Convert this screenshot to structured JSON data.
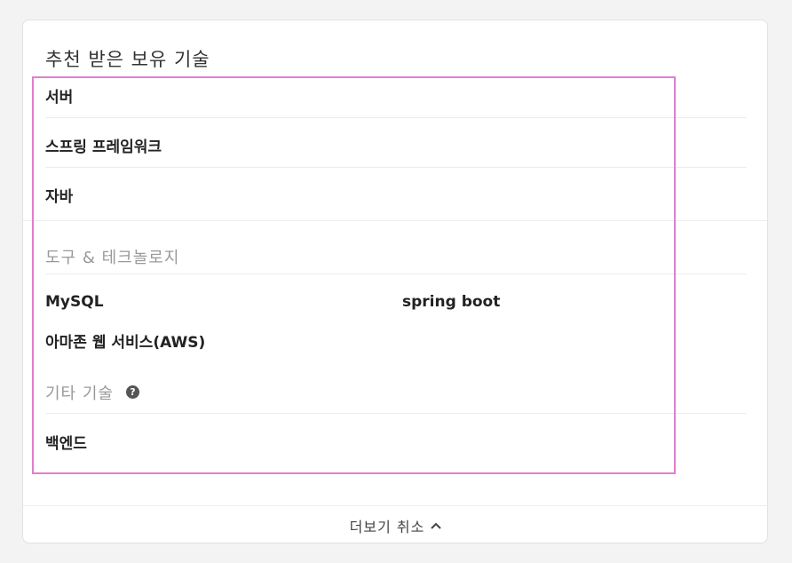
{
  "card": {
    "title": "추천 받은 보유 기술"
  },
  "skills": {
    "primary": [
      "서버",
      "스프링 프레임워크",
      "자바"
    ]
  },
  "tools_section": {
    "label": "도구 & 테크놀로지",
    "items": [
      "MySQL",
      "spring boot",
      "아마존 웹 서비스(AWS)"
    ]
  },
  "other_section": {
    "label": "기타 기술",
    "help_icon": "question-circle-icon",
    "items": [
      "백엔드"
    ]
  },
  "footer": {
    "toggle_label": "더보기 취소",
    "toggle_icon": "chevron-up-icon"
  },
  "colors": {
    "highlight": "#df7fd0",
    "muted_text": "#999999"
  }
}
